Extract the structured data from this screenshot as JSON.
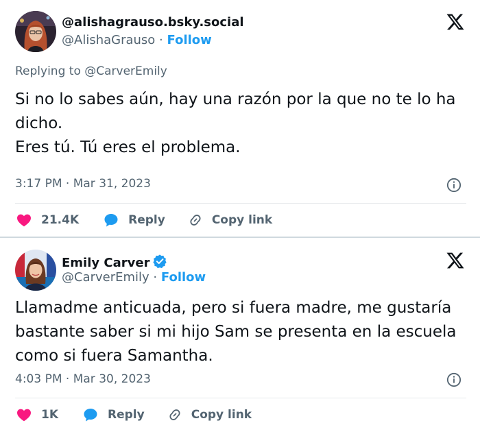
{
  "colors": {
    "heart": "#f91880",
    "reply_bubble": "#1d9bf0",
    "link": "#1d9bf0",
    "secondary_text": "#536471",
    "primary_text": "#0f1419",
    "verified": "#1d9bf0"
  },
  "tweets": [
    {
      "display_name": "@alishagrauso.bsky.social",
      "handle": "@AlishaGrauso",
      "separator": "·",
      "follow_label": "Follow",
      "replying_to": "Replying to @CarverEmily",
      "text_lines": [
        "Si no lo sabes aún, hay una razón por la que no te lo ha dicho.",
        "Eres tú. Tú eres el problema."
      ],
      "timestamp": "3:17 PM · Mar 31, 2023",
      "likes": "21.4K",
      "reply_label": "Reply",
      "copy_link_label": "Copy link",
      "icons": [
        "x-logo-icon",
        "info-icon",
        "heart-icon",
        "reply-bubble-icon",
        "link-icon"
      ]
    },
    {
      "display_name": "Emily Carver",
      "verified": true,
      "handle": "@CarverEmily",
      "separator": "·",
      "follow_label": "Follow",
      "text_lines": [
        "Llamadme anticuada, pero si fuera madre, me gustaría bastante saber si mi hijo Sam se presenta en la escuela como si fuera Samantha."
      ],
      "timestamp": "4:03 PM · Mar 30, 2023",
      "likes": "1K",
      "reply_label": "Reply",
      "copy_link_label": "Copy link",
      "icons": [
        "x-logo-icon",
        "verified-badge-icon",
        "info-icon",
        "heart-icon",
        "reply-bubble-icon",
        "link-icon"
      ]
    }
  ]
}
